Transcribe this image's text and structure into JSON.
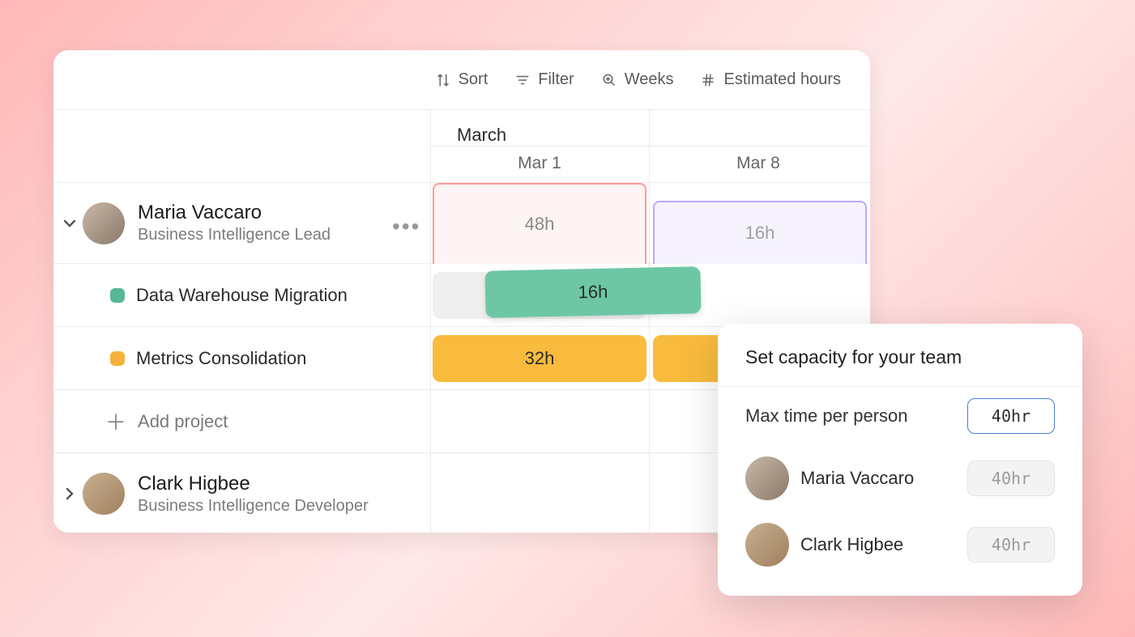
{
  "toolbar": {
    "sort": "Sort",
    "filter": "Filter",
    "weeks": "Weeks",
    "estimated_hours": "Estimated hours"
  },
  "timeline": {
    "month": "March",
    "dates": [
      "Mar 1",
      "Mar 8"
    ]
  },
  "people": [
    {
      "name": "Maria Vaccaro",
      "role": "Business Intelligence Lead",
      "capacity": [
        "48h",
        "16h"
      ],
      "projects": [
        {
          "name": "Data Warehouse Migration",
          "color": "green",
          "hours": "16h"
        },
        {
          "name": "Metrics Consolidation",
          "color": "yellow",
          "hours": "32h"
        }
      ]
    },
    {
      "name": "Clark Higbee",
      "role": "Business Intelligence Developer"
    }
  ],
  "add_project": "Add project",
  "popover": {
    "title": "Set capacity for your team",
    "max_label": "Max time per person",
    "max_value": "40hr",
    "rows": [
      {
        "name": "Maria Vaccaro",
        "value": "40hr"
      },
      {
        "name": "Clark Higbee",
        "value": "40hr"
      }
    ]
  }
}
